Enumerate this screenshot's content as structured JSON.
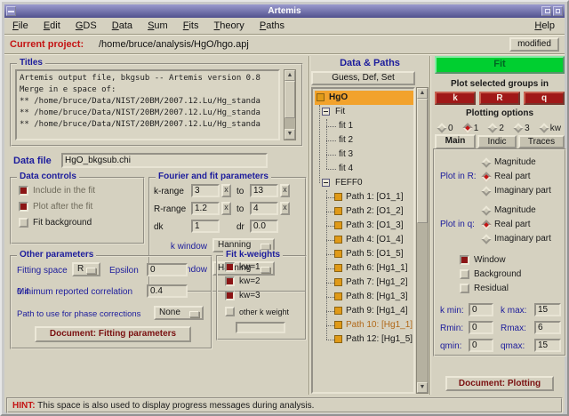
{
  "window": {
    "title": "Artemis"
  },
  "menu": {
    "items": [
      "File",
      "Edit",
      "GDS",
      "Data",
      "Sum",
      "Fits",
      "Theory",
      "Paths"
    ],
    "help": "Help"
  },
  "project": {
    "label": "Current project:",
    "path": "/home/bruce/analysis/HgO/hgo.apj",
    "modified": "modified"
  },
  "titles": {
    "label": "Titles",
    "lines": [
      "Artemis output file, bkgsub -- Artemis version 0.8",
      "Merge in e space of:",
      "** /home/bruce/Data/NIST/20BM/2007.12.Lu/Hg_standa",
      "** /home/bruce/Data/NIST/20BM/2007.12.Lu/Hg_standa",
      "** /home/bruce/Data/NIST/20BM/2007.12.Lu/Hg_standa"
    ]
  },
  "data_file": {
    "label": "Data file",
    "value": "HgO_bkgsub.chi"
  },
  "data_controls": {
    "label": "Data controls",
    "options": [
      {
        "label": "Include in the fit",
        "checked": true
      },
      {
        "label": "Plot after the fit",
        "checked": true
      },
      {
        "label": "Fit background",
        "checked": false
      }
    ]
  },
  "fourier": {
    "label": "Fourier and fit parameters",
    "k_range_label": "k-range",
    "k_from": "3",
    "to1": "to",
    "k_to": "13",
    "r_range_label": "R-range",
    "r_from": "1.2",
    "to2": "to",
    "r_to": "4",
    "dk_label": "dk",
    "dk": "1",
    "dr_label": "dr",
    "dr": "0.0",
    "k_window_label": "k window",
    "k_window": "Hanning",
    "r_window_label": "R window",
    "r_window": "Hanning"
  },
  "other": {
    "label": "Other parameters",
    "fitting_space_label": "Fitting space",
    "fitting_space": "R",
    "epsilon_label": "Epsilon",
    "epsilon": "0",
    "min_corr_label": "Minimum reported correlation",
    "min_corr": "0.4",
    "phase_label": "Path to use for phase corrections",
    "phase": "None",
    "doc_button": "Document: Fitting parameters"
  },
  "kweights": {
    "label": "Fit k-weights",
    "options": [
      {
        "label": "kw=1",
        "checked": true
      },
      {
        "label": "kw=2",
        "checked": true
      },
      {
        "label": "kw=3",
        "checked": true
      },
      {
        "label": "other k weight",
        "checked": false
      }
    ],
    "other_value": ""
  },
  "tree": {
    "header": "Data & Paths",
    "gds": "Guess, Def, Set",
    "root": "HgO",
    "fit": "Fit",
    "fits": [
      "fit 1",
      "fit 2",
      "fit 3",
      "fit 4"
    ],
    "feff": "FEFF0",
    "paths": [
      {
        "label": "Path 1: [O1_1]"
      },
      {
        "label": "Path 2: [O1_2]"
      },
      {
        "label": "Path 3: [O1_3]"
      },
      {
        "label": "Path 4: [O1_4]"
      },
      {
        "label": "Path 5: [O1_5]"
      },
      {
        "label": "Path 6: [Hg1_1]"
      },
      {
        "label": "Path 7: [Hg1_2]"
      },
      {
        "label": "Path 8: [Hg1_3]"
      },
      {
        "label": "Path 9: [Hg1_4]"
      },
      {
        "label": "Path 10: [Hg1_1]",
        "marked": true
      },
      {
        "label": "Path 12: [Hg1_5]"
      }
    ]
  },
  "plot": {
    "fit_button": "Fit",
    "groups_label": "Plot selected groups in",
    "spaces": [
      "k",
      "R",
      "q"
    ],
    "options_label": "Plotting options",
    "kw_options": [
      {
        "label": "0",
        "selected": false
      },
      {
        "label": "1",
        "selected": true
      },
      {
        "label": "2",
        "selected": false
      },
      {
        "label": "3",
        "selected": false
      },
      {
        "label": "kw",
        "selected": false
      }
    ],
    "tabs": [
      {
        "label": "Main",
        "active": true
      },
      {
        "label": "Indic",
        "active": false
      },
      {
        "label": "Traces",
        "active": false
      }
    ],
    "r_label": "Plot in R:",
    "r_options": [
      {
        "label": "Magnitude",
        "selected": false
      },
      {
        "label": "Real part",
        "selected": true
      },
      {
        "label": "Imaginary part",
        "selected": false
      }
    ],
    "q_label": "Plot in q:",
    "q_options": [
      {
        "label": "Magnitude",
        "selected": false
      },
      {
        "label": "Real part",
        "selected": true
      },
      {
        "label": "Imaginary part",
        "selected": false
      }
    ],
    "toggles": [
      {
        "label": "Window",
        "checked": true
      },
      {
        "label": "Background",
        "checked": false
      },
      {
        "label": "Residual",
        "checked": false
      }
    ],
    "ranges": [
      {
        "min_label": "k min:",
        "min": "0",
        "max_label": "k max:",
        "max": "15"
      },
      {
        "min_label": "Rmin:",
        "min": "0",
        "max_label": "Rmax:",
        "max": "6"
      },
      {
        "min_label": "qmin:",
        "min": "0",
        "max_label": "qmax:",
        "max": "15"
      }
    ],
    "doc_button": "Document: Plotting"
  },
  "status": {
    "hint": "HINT:",
    "text": "This space is also used to display progress messages during analysis."
  },
  "colors": {
    "titlebar": "#6a6aaa",
    "accent_navy": "#1c1c9c",
    "alert_red": "#c41414",
    "fit_green": "#00cf30",
    "plot_button_red": "#a01818",
    "selected_orange": "#f2a22c",
    "checked_maroon": "#8b1515",
    "marked_path": "#b06818"
  }
}
